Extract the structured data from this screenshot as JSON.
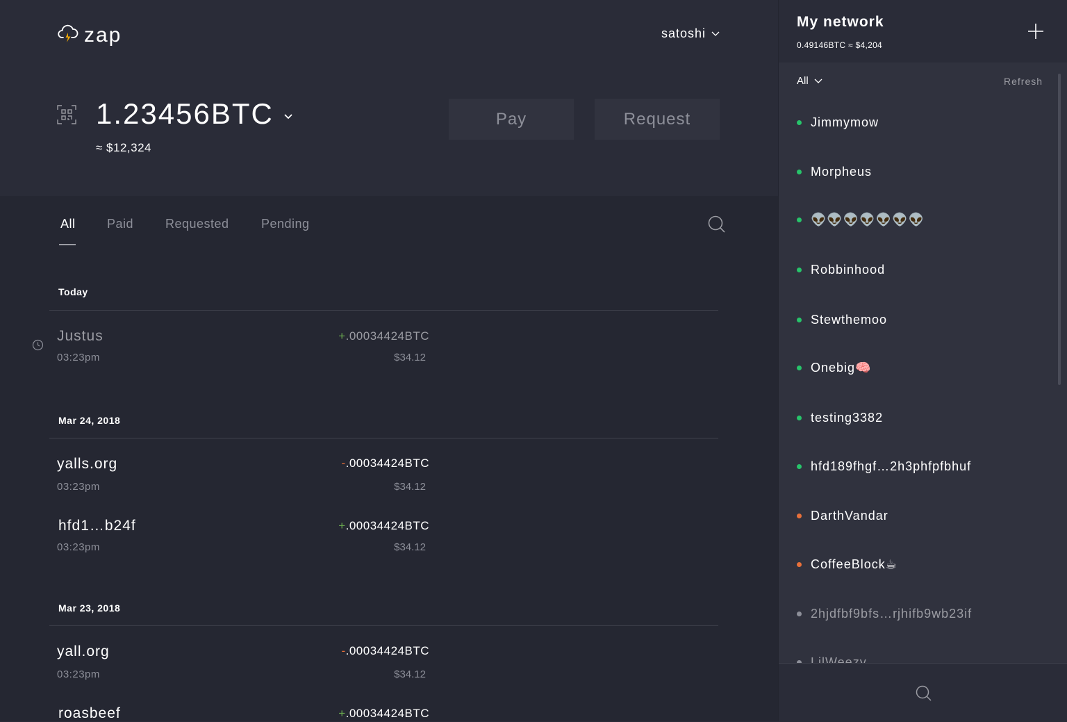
{
  "app": {
    "name": "zap",
    "logo_icon": "cloud-lightning-icon"
  },
  "user": {
    "name": "satoshi"
  },
  "wallet": {
    "balance": "1.23456BTC",
    "balance_fiat": "≈ $12,324",
    "pay_label": "Pay",
    "request_label": "Request"
  },
  "tabs": [
    {
      "label": "All",
      "active": true
    },
    {
      "label": "Paid",
      "active": false
    },
    {
      "label": "Requested",
      "active": false
    },
    {
      "label": "Pending",
      "active": false
    }
  ],
  "activity": [
    {
      "date": "Today",
      "items": [
        {
          "name": "Justus",
          "time": "03:23pm",
          "sign": "+",
          "amount": ".00034424BTC",
          "fiat": "$34.12",
          "pending": true
        }
      ]
    },
    {
      "date": "Mar 24, 2018",
      "items": [
        {
          "name": "yalls.org",
          "time": "03:23pm",
          "sign": "-",
          "amount": ".00034424BTC",
          "fiat": "$34.12",
          "pending": false
        },
        {
          "name": "hfd1…b24f",
          "time": "03:23pm",
          "sign": "+",
          "amount": ".00034424BTC",
          "fiat": "$34.12",
          "pending": false
        }
      ]
    },
    {
      "date": "Mar 23, 2018",
      "items": [
        {
          "name": "yall.org",
          "time": "03:23pm",
          "sign": "-",
          "amount": ".00034424BTC",
          "fiat": "$34.12",
          "pending": false
        },
        {
          "name": "roasbeef",
          "time": "",
          "sign": "+",
          "amount": ".00034424BTC",
          "fiat": "",
          "pending": false
        }
      ]
    }
  ],
  "network": {
    "title": "My network",
    "balance": "0.49146BTC ≈ $4,204",
    "filter": "All",
    "refresh_label": "Refresh",
    "status_colors": {
      "online": "#27c46a",
      "pending": "#e8703a",
      "offline": "#8d8f99"
    },
    "peers": [
      {
        "name": "Jimmymow",
        "status": "online"
      },
      {
        "name": "Morpheus",
        "status": "online"
      },
      {
        "name": "👽👽👽👽👽👽👽",
        "status": "online"
      },
      {
        "name": "Robbinhood",
        "status": "online"
      },
      {
        "name": "Stewthemoo",
        "status": "online"
      },
      {
        "name": "Onebig🧠",
        "status": "online"
      },
      {
        "name": "testing3382",
        "status": "online"
      },
      {
        "name": "hfd189fhgf…2h3phfpfbhuf",
        "status": "online"
      },
      {
        "name": "DarthVandar",
        "status": "pending"
      },
      {
        "name": "CoffeeBlock☕",
        "status": "pending"
      },
      {
        "name": "2hjdfbf9bfs…rjhifb9wb23if",
        "status": "offline"
      },
      {
        "name": "LilWeezy",
        "status": "offline"
      }
    ]
  }
}
